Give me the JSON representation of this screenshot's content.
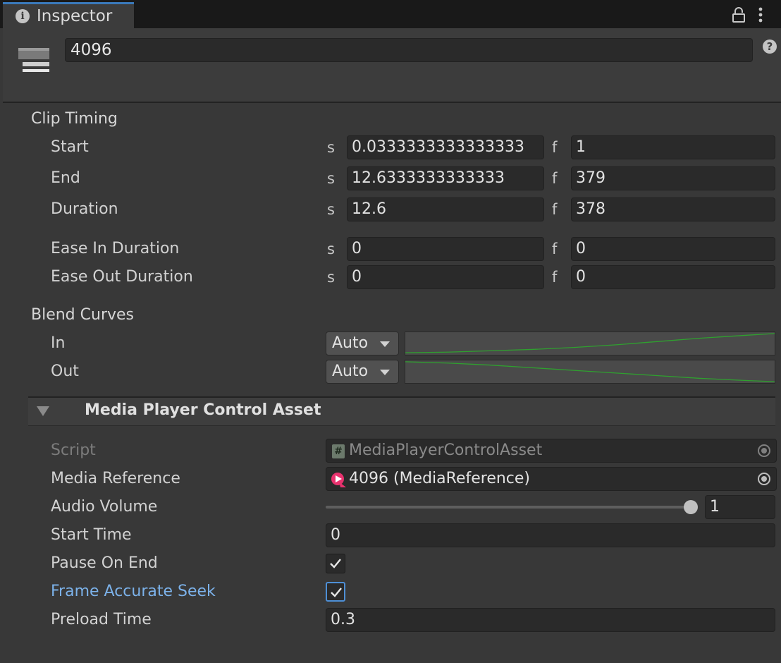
{
  "tab": {
    "title": "Inspector",
    "icon": "info-icon"
  },
  "toolbar_icons": [
    "lock-icon",
    "kebab-menu-icon"
  ],
  "header": {
    "object_name": "4096",
    "icon": "timeline-clip-icon",
    "help_icon": "?"
  },
  "clip_timing": {
    "title": "Clip Timing",
    "seconds_prefix": "s",
    "frames_prefix": "f",
    "rows": [
      {
        "label": "Start",
        "seconds": "0.0333333333333333",
        "frames": "1"
      },
      {
        "label": "End",
        "seconds": "12.6333333333333",
        "frames": "379"
      },
      {
        "label": "Duration",
        "seconds": "12.6",
        "frames": "378"
      },
      {
        "label": "Ease In Duration",
        "seconds": "0",
        "frames": "0"
      },
      {
        "label": "Ease Out Duration",
        "seconds": "0",
        "frames": "0"
      }
    ]
  },
  "blend_curves": {
    "title": "Blend Curves",
    "in": {
      "label": "In",
      "mode": "Auto"
    },
    "out": {
      "label": "Out",
      "mode": "Auto"
    },
    "curve_color": "#2fa02f"
  },
  "component": {
    "title": "Media Player Control Asset",
    "script": {
      "label": "Script",
      "value": "MediaPlayerControlAsset"
    },
    "media_reference": {
      "label": "Media Reference",
      "value": "4096 (MediaReference)"
    },
    "audio_volume": {
      "label": "Audio Volume",
      "value": "1",
      "fraction": 1.0
    },
    "start_time": {
      "label": "Start Time",
      "value": "0"
    },
    "pause_on_end": {
      "label": "Pause On End",
      "checked": true
    },
    "frame_accurate_seek": {
      "label": "Frame Accurate Seek",
      "checked": true
    },
    "preload_time": {
      "label": "Preload Time",
      "value": "0.3"
    }
  },
  "colors": {
    "accent": "#3a79bb",
    "highlight_label": "#7cb2ea",
    "background": "#383838"
  }
}
